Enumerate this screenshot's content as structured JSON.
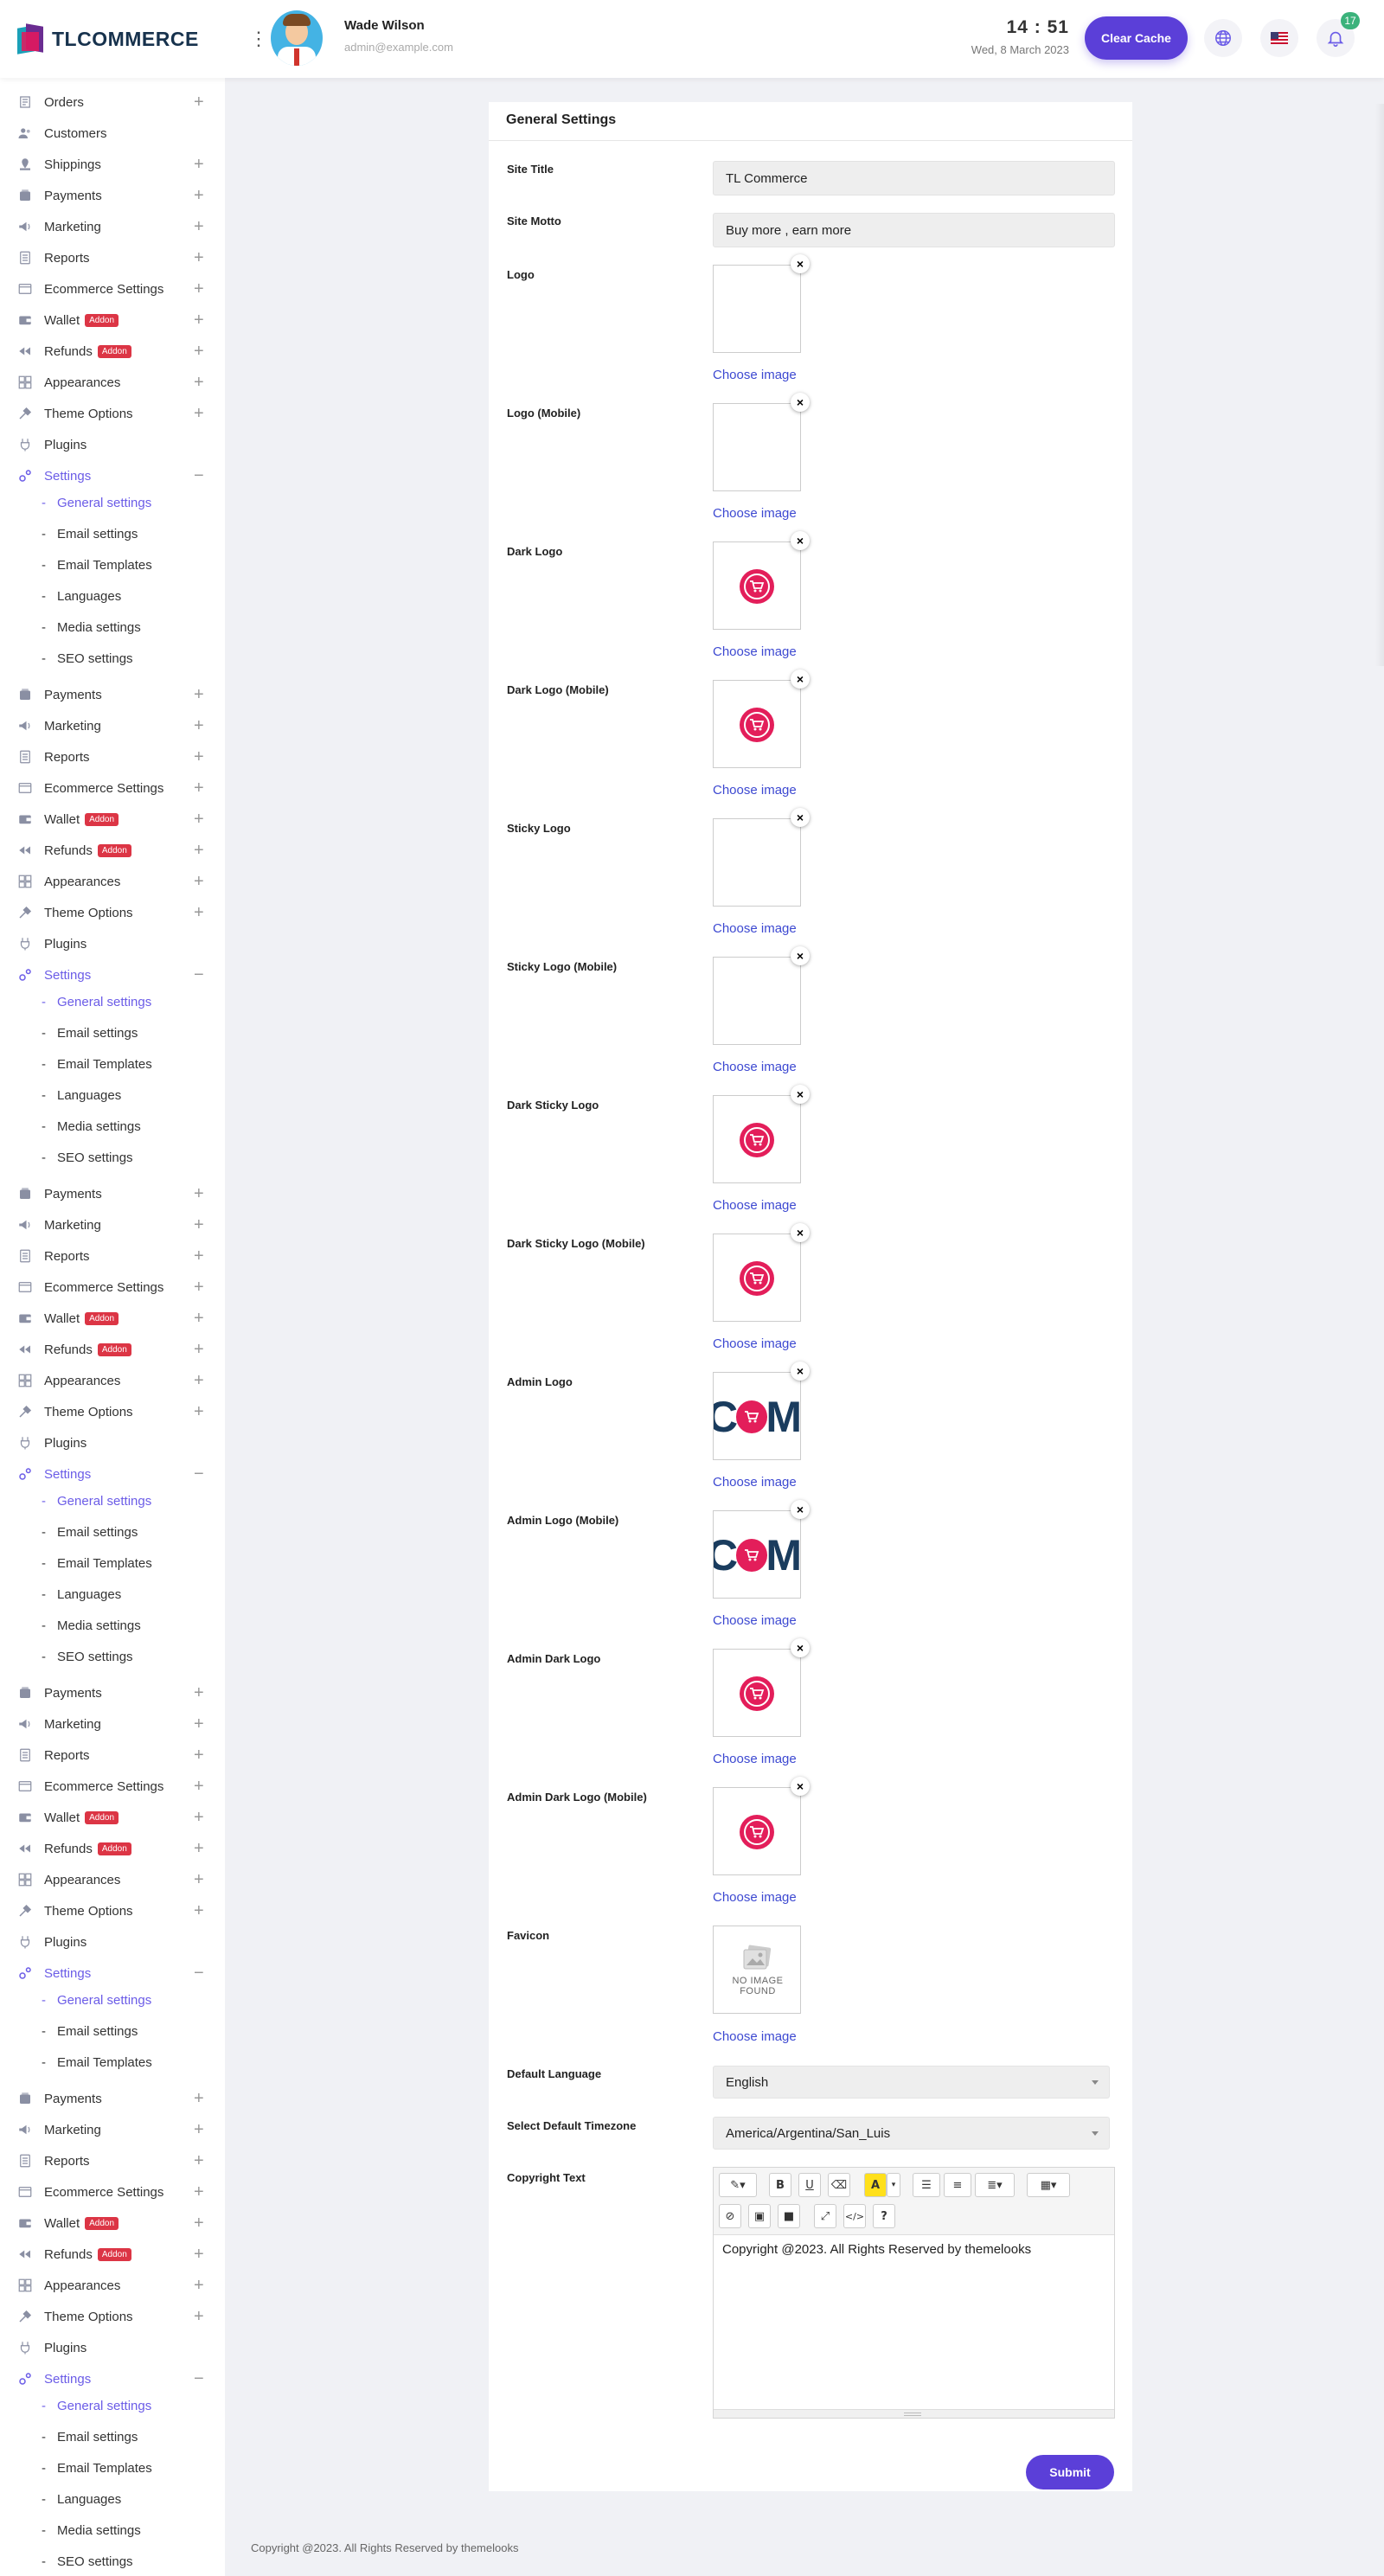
{
  "header": {
    "brand": "TLCOMMERCE",
    "user_name": "Wade Wilson",
    "user_email": "admin@example.com",
    "time": "14 : 51",
    "date": "Wed, 8 March 2023",
    "clear_cache_label": "Clear Cache",
    "notification_count": "17"
  },
  "sidebar": {
    "addon_label": "Addon",
    "labels": {
      "orders": "Orders",
      "customers": "Customers",
      "shippings": "Shippings",
      "payments": "Payments",
      "marketing": "Marketing",
      "reports": "Reports",
      "ecommerce_settings": "Ecommerce Settings",
      "wallet": "Wallet",
      "refunds": "Refunds",
      "appearances": "Appearances",
      "theme_options": "Theme Options",
      "plugins": "Plugins",
      "settings": "Settings",
      "general_settings": "General settings",
      "email_settings": "Email settings",
      "email_templates": "Email Templates",
      "languages": "Languages",
      "media_settings": "Media settings",
      "seo_settings": "SEO settings"
    }
  },
  "form": {
    "title": "General Settings",
    "site_title_label": "Site Title",
    "site_title_value": "TL Commerce",
    "site_motto_label": "Site Motto",
    "site_motto_value": "Buy more , earn more",
    "choose_image_label": "Choose image",
    "remove_symbol": "×",
    "images": [
      {
        "label": "Logo",
        "kind": "empty"
      },
      {
        "label": "Logo (Mobile)",
        "kind": "empty"
      },
      {
        "label": "Dark Logo",
        "kind": "cart"
      },
      {
        "label": "Dark Logo (Mobile)",
        "kind": "cart"
      },
      {
        "label": "Sticky Logo",
        "kind": "empty"
      },
      {
        "label": "Sticky Logo (Mobile)",
        "kind": "empty"
      },
      {
        "label": "Dark Sticky Logo",
        "kind": "cart"
      },
      {
        "label": "Dark Sticky Logo (Mobile)",
        "kind": "cart"
      },
      {
        "label": "Admin Logo",
        "kind": "admin"
      },
      {
        "label": "Admin Logo (Mobile)",
        "kind": "admin"
      },
      {
        "label": "Admin Dark Logo",
        "kind": "cart"
      },
      {
        "label": "Admin Dark Logo (Mobile)",
        "kind": "cart"
      }
    ],
    "favicon_label": "Favicon",
    "no_image_text_1": "NO IMAGE",
    "no_image_text_2": "FOUND",
    "default_language_label": "Default Language",
    "default_language_value": "English",
    "timezone_label": "Select Default Timezone",
    "timezone_value": "America/Argentina/San_Luis",
    "copyright_label": "Copyright Text",
    "copyright_value": "Copyright @2023. All Rights Reserved by themelooks",
    "submit_label": "Submit"
  },
  "footer": {
    "text": "Copyright @2023. All Rights Reserved by themelooks"
  },
  "colors": {
    "accent": "#5b3fd8",
    "link": "#3d49d1",
    "addon_badge": "#dc3545",
    "notification_badge": "#3bb27b",
    "brand_cart": "#e31e5a"
  }
}
